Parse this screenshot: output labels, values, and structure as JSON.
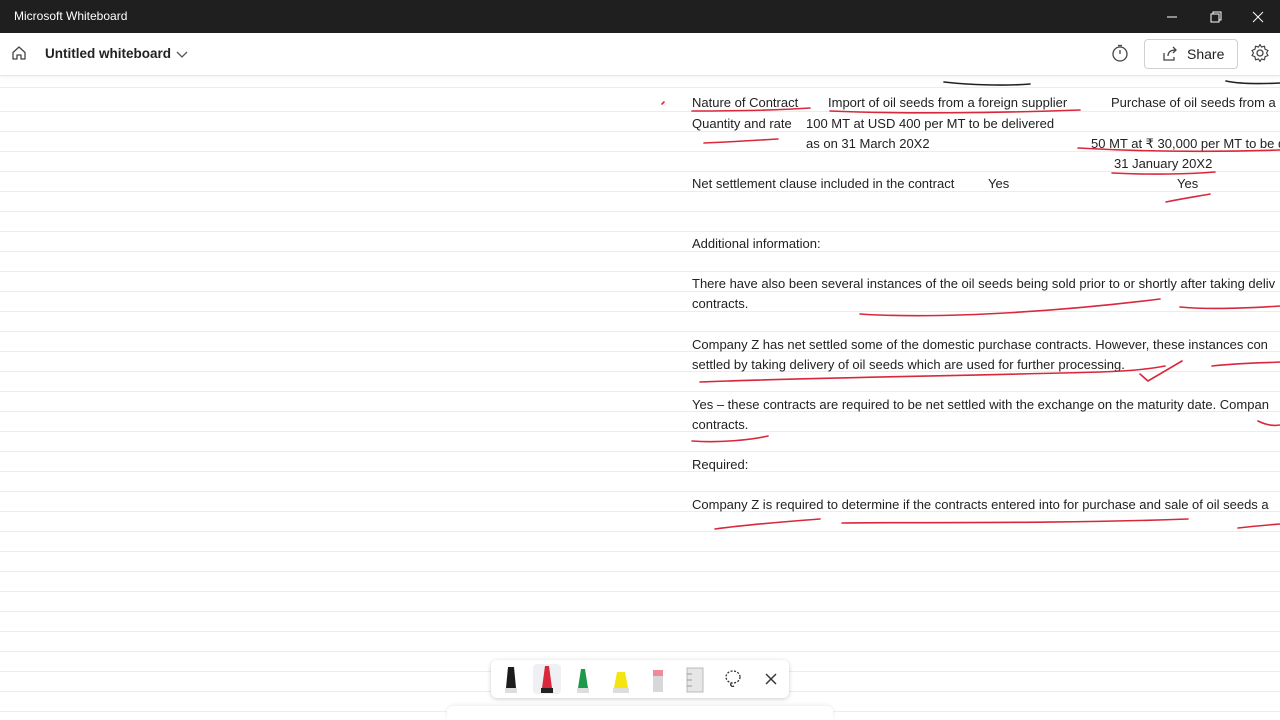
{
  "window": {
    "app_title": "Microsoft Whiteboard"
  },
  "appbar": {
    "board_title": "Untitled whiteboard",
    "share_label": "Share"
  },
  "doc": {
    "nature_label": "Nature of Contract",
    "nature_import": "Import of oil seeds from a foreign supplier",
    "nature_purchase": "Purchase of oil seeds from a",
    "qty_label": "Quantity and rate",
    "qty_import_1": "100 MT at USD 400 per MT to be delivered",
    "qty_import_2": "as on 31 March 20X2",
    "qty_purchase_1": "50 MT at ₹ 30,000 per MT to be d",
    "qty_purchase_2": "31 January 20X2",
    "net_label": "Net settlement clause included in the contract",
    "net_import": "Yes",
    "net_purchase": "Yes",
    "additional_heading": "Additional information:",
    "para1_line1": "There have also been several instances of the oil seeds being sold prior to or shortly after taking deliv",
    "para1_line2": "contracts.",
    "para2_line1": "Company Z has net settled some of the domestic purchase contracts. However, these instances con",
    "para2_line2": "settled by taking delivery of oil seeds which are used for further processing.",
    "para3_line1": "Yes – these contracts are required to be net settled with the exchange on the maturity date. Compan",
    "para3_line2": "contracts.",
    "required_heading": "Required:",
    "required_text": "Company Z is required to determine if the contracts entered into for purchase and sale of oil seeds a"
  },
  "ink_colors": {
    "red": "#d9283b",
    "black": "#222222"
  },
  "toolbar": {
    "tools": [
      "black-pen",
      "red-pen",
      "green-pen",
      "yellow-highlighter",
      "eraser",
      "ruler",
      "lasso",
      "close"
    ]
  }
}
